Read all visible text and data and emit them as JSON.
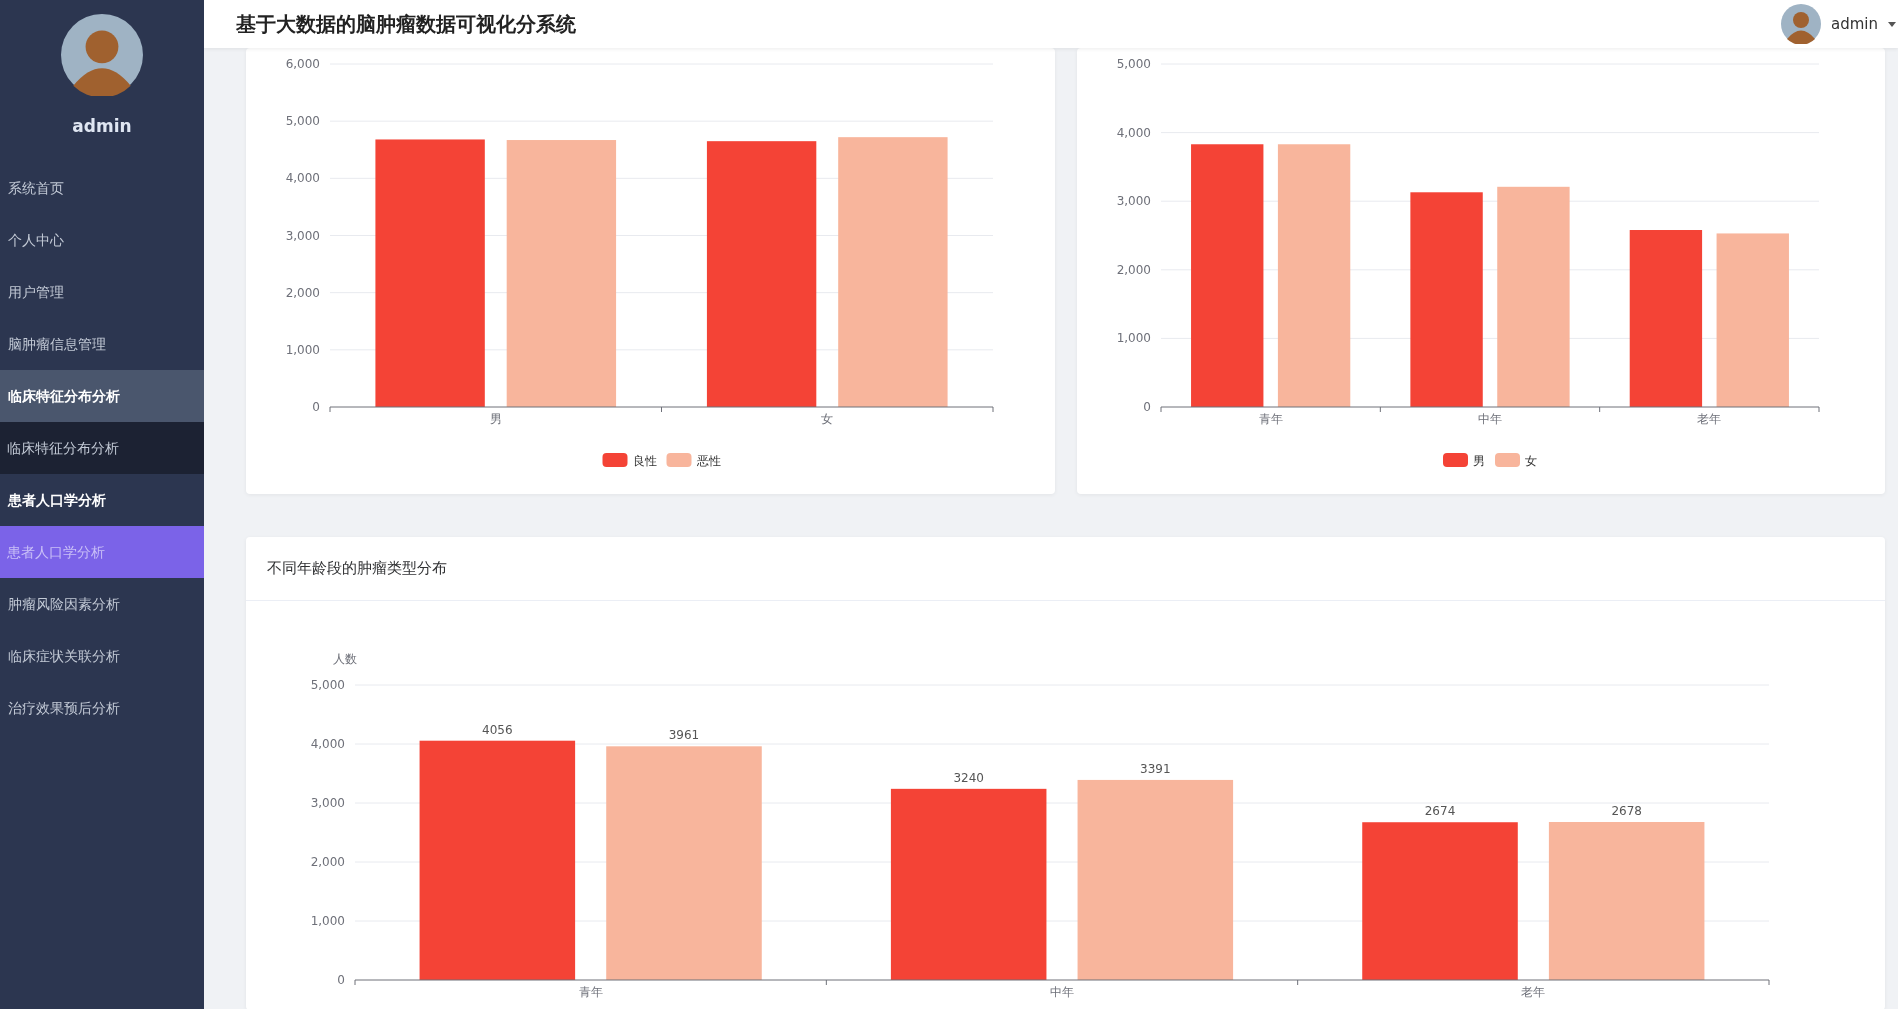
{
  "header": {
    "title": "基于大数据的脑肿瘤数据可视化分系统",
    "user": "admin"
  },
  "sidebar": {
    "user": "admin",
    "menu": [
      {
        "label": "系统首页",
        "expanded": false
      },
      {
        "label": "个人中心",
        "expanded": false
      },
      {
        "label": "用户管理",
        "expanded": false
      },
      {
        "label": "脑肿瘤信息管理",
        "expanded": false
      },
      {
        "label": "临床特征分布分析",
        "expanded": true,
        "hovered": true,
        "children": [
          {
            "label": "临床特征分布分析",
            "selected": false
          }
        ]
      },
      {
        "label": "患者人口学分析",
        "expanded": true,
        "hovered": false,
        "children": [
          {
            "label": "患者人口学分析",
            "selected": true
          }
        ]
      },
      {
        "label": "肿瘤风险因素分析",
        "expanded": false
      },
      {
        "label": "临床症状关联分析",
        "expanded": false
      },
      {
        "label": "治疗效果预后分析",
        "expanded": false
      }
    ]
  },
  "panels": [
    {
      "chart_data": {
        "type": "bar",
        "categories": [
          "男",
          "女"
        ],
        "ylim": [
          0,
          6000
        ],
        "grid": true,
        "legend": true,
        "yticks": [
          {
            "value": 0,
            "label": "0"
          },
          {
            "value": 1000,
            "label": "1,000"
          },
          {
            "value": 2000,
            "label": "2,000"
          },
          {
            "value": 3000,
            "label": "3,000"
          },
          {
            "value": 4000,
            "label": "4,000"
          },
          {
            "value": 5000,
            "label": "5,000"
          },
          {
            "value": 6000,
            "label": "6,000"
          }
        ],
        "series": [
          {
            "name": "良性",
            "color": "#f44336",
            "values": [
              4680,
              4650
            ]
          },
          {
            "name": "恶性",
            "color": "#f8b59c",
            "values": [
              4670,
              4720
            ]
          }
        ]
      }
    },
    {
      "chart_data": {
        "type": "bar",
        "categories": [
          "青年",
          "中年",
          "老年"
        ],
        "ylim": [
          0,
          5000
        ],
        "grid": true,
        "legend": true,
        "yticks": [
          {
            "value": 0,
            "label": "0"
          },
          {
            "value": 1000,
            "label": "1,000"
          },
          {
            "value": 2000,
            "label": "2,000"
          },
          {
            "value": 3000,
            "label": "3,000"
          },
          {
            "value": 4000,
            "label": "4,000"
          },
          {
            "value": 5000,
            "label": "5,000"
          }
        ],
        "series": [
          {
            "name": "男",
            "color": "#f44336",
            "values": [
              3830,
              3130,
              2580
            ]
          },
          {
            "name": "女",
            "color": "#f8b59c",
            "values": [
              3830,
              3210,
              2530
            ]
          }
        ]
      }
    },
    {
      "title": "不同年龄段的肿瘤类型分布",
      "chart_data": {
        "type": "bar",
        "ylabel": "人数",
        "categories": [
          "青年",
          "中年",
          "老年"
        ],
        "ylim": [
          0,
          5000
        ],
        "grid": true,
        "yticks": [
          {
            "value": 0,
            "label": "0"
          },
          {
            "value": 1000,
            "label": "1,000"
          },
          {
            "value": 2000,
            "label": "2,000"
          },
          {
            "value": 3000,
            "label": "3,000"
          },
          {
            "value": 4000,
            "label": "4,000"
          },
          {
            "value": 5000,
            "label": "5,000"
          }
        ],
        "data_labels": true,
        "series": [
          {
            "color": "#f44336",
            "values": [
              4056,
              3240,
              2674
            ]
          },
          {
            "color": "#f8b59c",
            "values": [
              3961,
              3391,
              2678
            ]
          }
        ]
      }
    }
  ]
}
